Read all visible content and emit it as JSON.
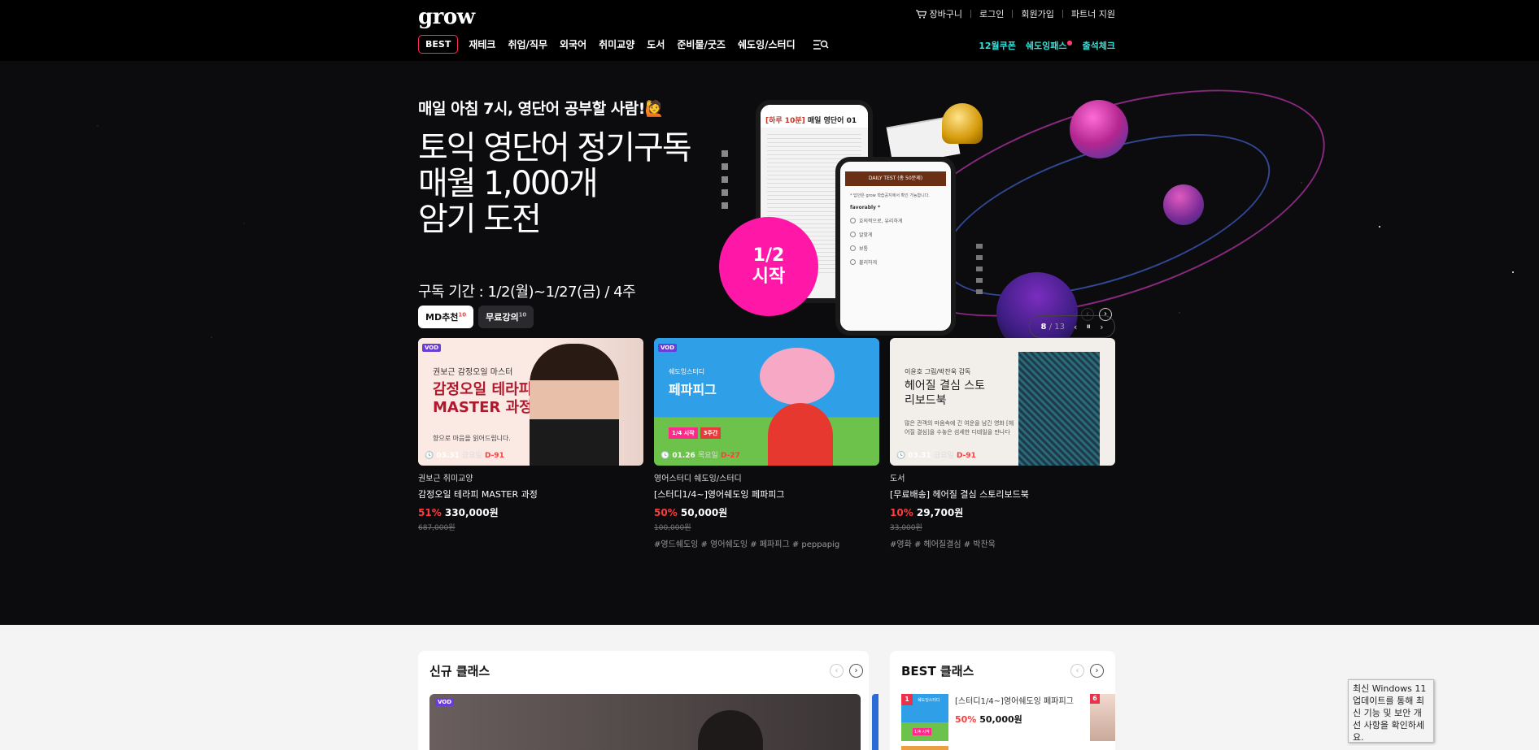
{
  "header": {
    "logo": "grow",
    "util": {
      "cart": "장바구니",
      "login": "로그인",
      "signup": "회원가입",
      "partner": "파트너 지원"
    },
    "nav": {
      "best": "BEST",
      "items": [
        "재테크",
        "취업/직무",
        "외국어",
        "취미교양",
        "도서",
        "준비물/굿즈",
        "쉐도잉/스터디"
      ],
      "right": {
        "coupon": "12월쿠폰",
        "shadowing": "쉐도잉패스",
        "shadowing_badge": "●",
        "attendance": "출석체크"
      }
    }
  },
  "hero": {
    "subtitle": "매일 아침 7시, 영단어 공부할 사람!🙋",
    "title_lines": [
      "토익 영단어 정기구독",
      "매월 1,000개",
      "암기 도전"
    ],
    "period": "구독 기간 : 1/2(월)~1/27(금) / 4주",
    "circle_line1": "1/2",
    "circle_line2": "시작",
    "phone1": {
      "tag": "[하루 10분]",
      "title": "매일 영단어",
      "num": "01"
    },
    "phone2": {
      "bar": "DAILY TEST (총 50문제)",
      "note": "* 답안은 grow 학습공지에서 확인 가능합니다.",
      "word": "favorably *",
      "options": [
        "호의적으로, 유리하게",
        "알맞게",
        "보통",
        "불리하게"
      ]
    },
    "pager": {
      "current": "8",
      "total": "/ 13",
      "prev": "‹",
      "pause": "⏸",
      "next": "›"
    }
  },
  "tabs": [
    {
      "label": "MD추천",
      "count": "10"
    },
    {
      "label": "무료강의",
      "count": "10"
    }
  ],
  "carousel": {
    "prev": "‹",
    "next": "›"
  },
  "cards": [
    {
      "vod": "VOD",
      "thumb_small": "권보근 감정오일 마스터",
      "thumb_title": "감정오일 테라피 MASTER 과정",
      "thumb_desc": "향으로 마음을 읽어드립니다.",
      "date": "03.31",
      "dow": "금요일",
      "dday": "D-91",
      "category": "권보근 취미교양",
      "name": "감정오일 테라피 MASTER 과정",
      "discount": "51%",
      "price": "330,000원",
      "original": "687,000원",
      "tags": ""
    },
    {
      "vod": "VOD",
      "thumb_small": "쉐도잉스터디",
      "thumb_title": "페파피그",
      "badge1": "1/4 시작",
      "badge2": "3주간",
      "date": "01.26",
      "dow": "목요일",
      "dday": "D-27",
      "category": "영어스터디 쉐도잉/스터디",
      "name": "[스터디1/4~]영어쉐도잉 페파피그",
      "discount": "50%",
      "price": "50,000원",
      "original": "100,000원",
      "tags": "#영드쉐도잉 # 영어쉐도잉 # 페파피그 # peppapig"
    },
    {
      "vod": "",
      "thumb_small": "이윤호 그림/박찬욱 감독",
      "thumb_title": "헤어질 결심 스토리보드북",
      "thumb_desc": "많은 관객의 마음속에 긴 여운을 남긴 영화 [헤어질 결심]을 수놓은 섬세한 디테일을 만나다",
      "date": "03.31",
      "dow": "금요일",
      "dday": "D-91",
      "category": "도서",
      "name": "[무료배송] 헤어질 결심 스토리보드북",
      "discount": "10%",
      "price": "29,700원",
      "original": "33,000원",
      "tags": "#영화 # 헤어질결심 # 박찬욱"
    }
  ],
  "new_class": {
    "title": "신규 클래스",
    "vod": "VOD"
  },
  "best_class": {
    "title": "BEST 클래스",
    "rank1": "1",
    "item_name": "[스터디1/4~]영어쉐도잉 페파피그",
    "item_discount": "50%",
    "item_price": "50,000원",
    "side_rank": "6",
    "thumb_label": "쉐도잉스터디",
    "thumb_sub": "1/4 시작"
  },
  "toast": "최신 Windows 11 업데이트를 통해 최신 기능 및 보안 개선 사항을 확인하세요.",
  "colors": {
    "accent_pink": "#ff17a8",
    "discount_red": "#ff3b3b",
    "nav_cyan": "#34e0d8",
    "header_bg": "#000000"
  }
}
